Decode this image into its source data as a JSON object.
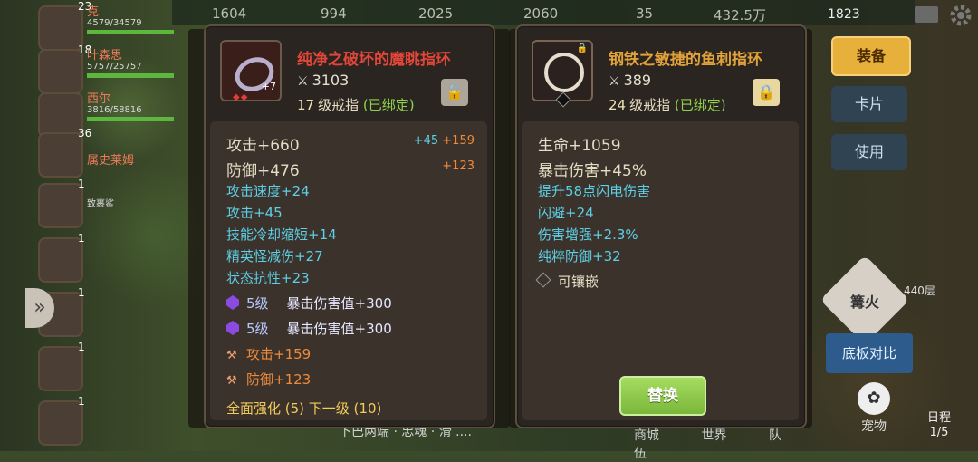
{
  "topbar": {
    "stats": [
      "1604",
      "994",
      "2025",
      "2060",
      "35",
      "432.5万"
    ],
    "diamonds": "1823"
  },
  "party": [
    {
      "level": "23",
      "name": "克",
      "hp": "4579/34579"
    },
    {
      "level": "18",
      "name": "叶森思",
      "hp": "5757/25757"
    },
    {
      "level": "",
      "name": "西尔",
      "hp": "3816/58816"
    },
    {
      "level": "36",
      "name": "属史莱姆",
      "hp": ""
    },
    {
      "level": "1",
      "name": "致裹鲨",
      "hp": ""
    },
    {
      "level": "1",
      "name": "",
      "hp": ""
    },
    {
      "level": "1",
      "name": "",
      "hp": ""
    },
    {
      "level": "1",
      "name": "",
      "hp": ""
    },
    {
      "level": "1",
      "name": "",
      "hp": ""
    }
  ],
  "right_menu": {
    "equip": "装备",
    "card": "卡片",
    "use": "使用",
    "bonfire": "篝火",
    "baseplate_compare": "底板对比",
    "floor": "440层",
    "pet": "宠物",
    "schedule": "日程",
    "schedule_count": "1/5"
  },
  "bottom": {
    "tabs": [
      "商城",
      "世界",
      "队伍"
    ],
    "chat": "下巴两端 · 忠魂 · 滑 ...."
  },
  "left_item": {
    "name": "纯净之破坏的魔眺指环",
    "power": "3103",
    "level": "17",
    "type": "级戒指",
    "bound": "(已绑定)",
    "enhance": "+7",
    "stats": [
      {
        "label": "攻击+660",
        "delta": "+45",
        "delta2": "+159"
      },
      {
        "label": "防御+476",
        "delta": "",
        "delta2": "+123"
      }
    ],
    "attrs": [
      "攻击速度+24",
      "攻击+45",
      "技能冷却缩短+14",
      "精英怪减伤+27",
      "状态抗性+23"
    ],
    "gems": [
      {
        "level": "5级",
        "text": "暴击伤害值+300"
      },
      {
        "level": "5级",
        "text": "暴击伤害值+300"
      }
    ],
    "forge": [
      "攻击+159",
      "防御+123"
    ],
    "full_enhance": "全面强化 (5) 下一级 (10)"
  },
  "right_item": {
    "name": "钢铁之敏捷的鱼刺指环",
    "power": "389",
    "level": "24",
    "type": "级戒指",
    "bound": "(已绑定)",
    "stats": [
      "生命+1059",
      "暴击伤害+45%"
    ],
    "attrs": [
      "提升58点闪电伤害",
      "闪避+24",
      "伤害增强+2.3%",
      "纯粹防御+32"
    ],
    "socket": "可镶嵌",
    "replace_label": "替换"
  },
  "colors": {
    "title_red": "#e2453a",
    "title_orange": "#e2a23a",
    "attr_cyan": "#5ccfe6",
    "forge_orange": "#f08a3a",
    "bound_green": "#8fd44a",
    "replace_green": "#79b73a"
  },
  "icons": [
    "settings-icon",
    "mail-icon",
    "lock-icon",
    "sword-icon",
    "gem-icon",
    "hammer-icon",
    "paw-icon",
    "chevron-left-icon"
  ]
}
